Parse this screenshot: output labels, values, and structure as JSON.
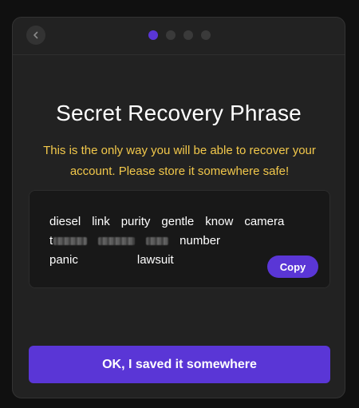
{
  "colors": {
    "background": "#101010",
    "panel": "#222222",
    "phrase_box": "#181818",
    "accent": "#5a36d6",
    "warning_text": "#f2c84b",
    "inactive_step": "#3a3a3a"
  },
  "header": {
    "back_icon": "chevron-left-icon",
    "steps": [
      {
        "active": true
      },
      {
        "active": false
      },
      {
        "active": false
      },
      {
        "active": false
      }
    ]
  },
  "main": {
    "title": "Secret Recovery Phrase",
    "warning": "This is the only way you will be able to recover your account. Please store it somewhere safe!",
    "phrase_words": [
      "diesel",
      "link",
      "purity",
      "gentle",
      "know",
      "camera",
      "t",
      "number",
      "panic",
      "lawsuit"
    ],
    "copy_label": "Copy"
  },
  "footer": {
    "confirm_label": "OK, I saved it somewhere"
  }
}
